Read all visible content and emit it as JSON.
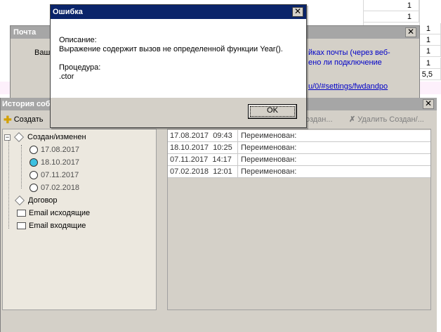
{
  "sheet": {
    "cells": [
      "1",
      "1",
      "1",
      "1",
      "1",
      "1",
      "5,5"
    ]
  },
  "mail_window": {
    "title": "Почта",
    "left_text": "Ваш",
    "link_line1": "йках почты (через веб-",
    "link_line2": "ено ли подключение",
    "link_line3": "u/0/#settings/fwdandpo"
  },
  "history_window": {
    "title": "История событий",
    "toolbar": {
      "create": "Создать",
      "create_disabled": "Создан...",
      "delete_disabled": "Удалить Создан/..."
    },
    "tree": {
      "root": "Создан/изменен",
      "dates": [
        "17.08.2017",
        "18.10.2017",
        "07.11.2017",
        "07.02.2018"
      ],
      "contract": "Договор",
      "email_out": "Email исходящие",
      "email_in": "Email входящие"
    },
    "rows": [
      {
        "date": "17.08.2017",
        "time": "09:43",
        "action": "Переименован:"
      },
      {
        "date": "18.10.2017",
        "time": "10:25",
        "action": "Переименован:"
      },
      {
        "date": "07.11.2017",
        "time": "14:17",
        "action": "Переименован:"
      },
      {
        "date": "07.02.2018",
        "time": "12:01",
        "action": "Переименован:"
      }
    ]
  },
  "error_dialog": {
    "title": "Ошибка",
    "description_label": "Описание:",
    "description_text": "Выражение содержит вызов не определенной функции Year().",
    "procedure_label": "Процедура:",
    "procedure_text": ".ctor",
    "ok_label": "OK"
  }
}
